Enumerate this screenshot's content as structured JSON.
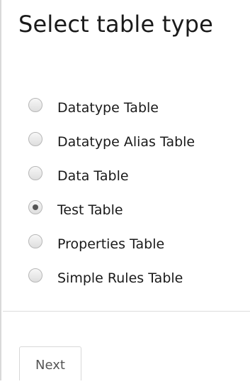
{
  "dialog": {
    "title": "Select table type",
    "options": [
      {
        "label": "Datatype Table",
        "selected": false
      },
      {
        "label": "Datatype Alias Table",
        "selected": false
      },
      {
        "label": "Data Table",
        "selected": false
      },
      {
        "label": "Test Table",
        "selected": true
      },
      {
        "label": "Properties Table",
        "selected": false
      },
      {
        "label": "Simple Rules Table",
        "selected": false
      }
    ],
    "next_label": "Next"
  }
}
